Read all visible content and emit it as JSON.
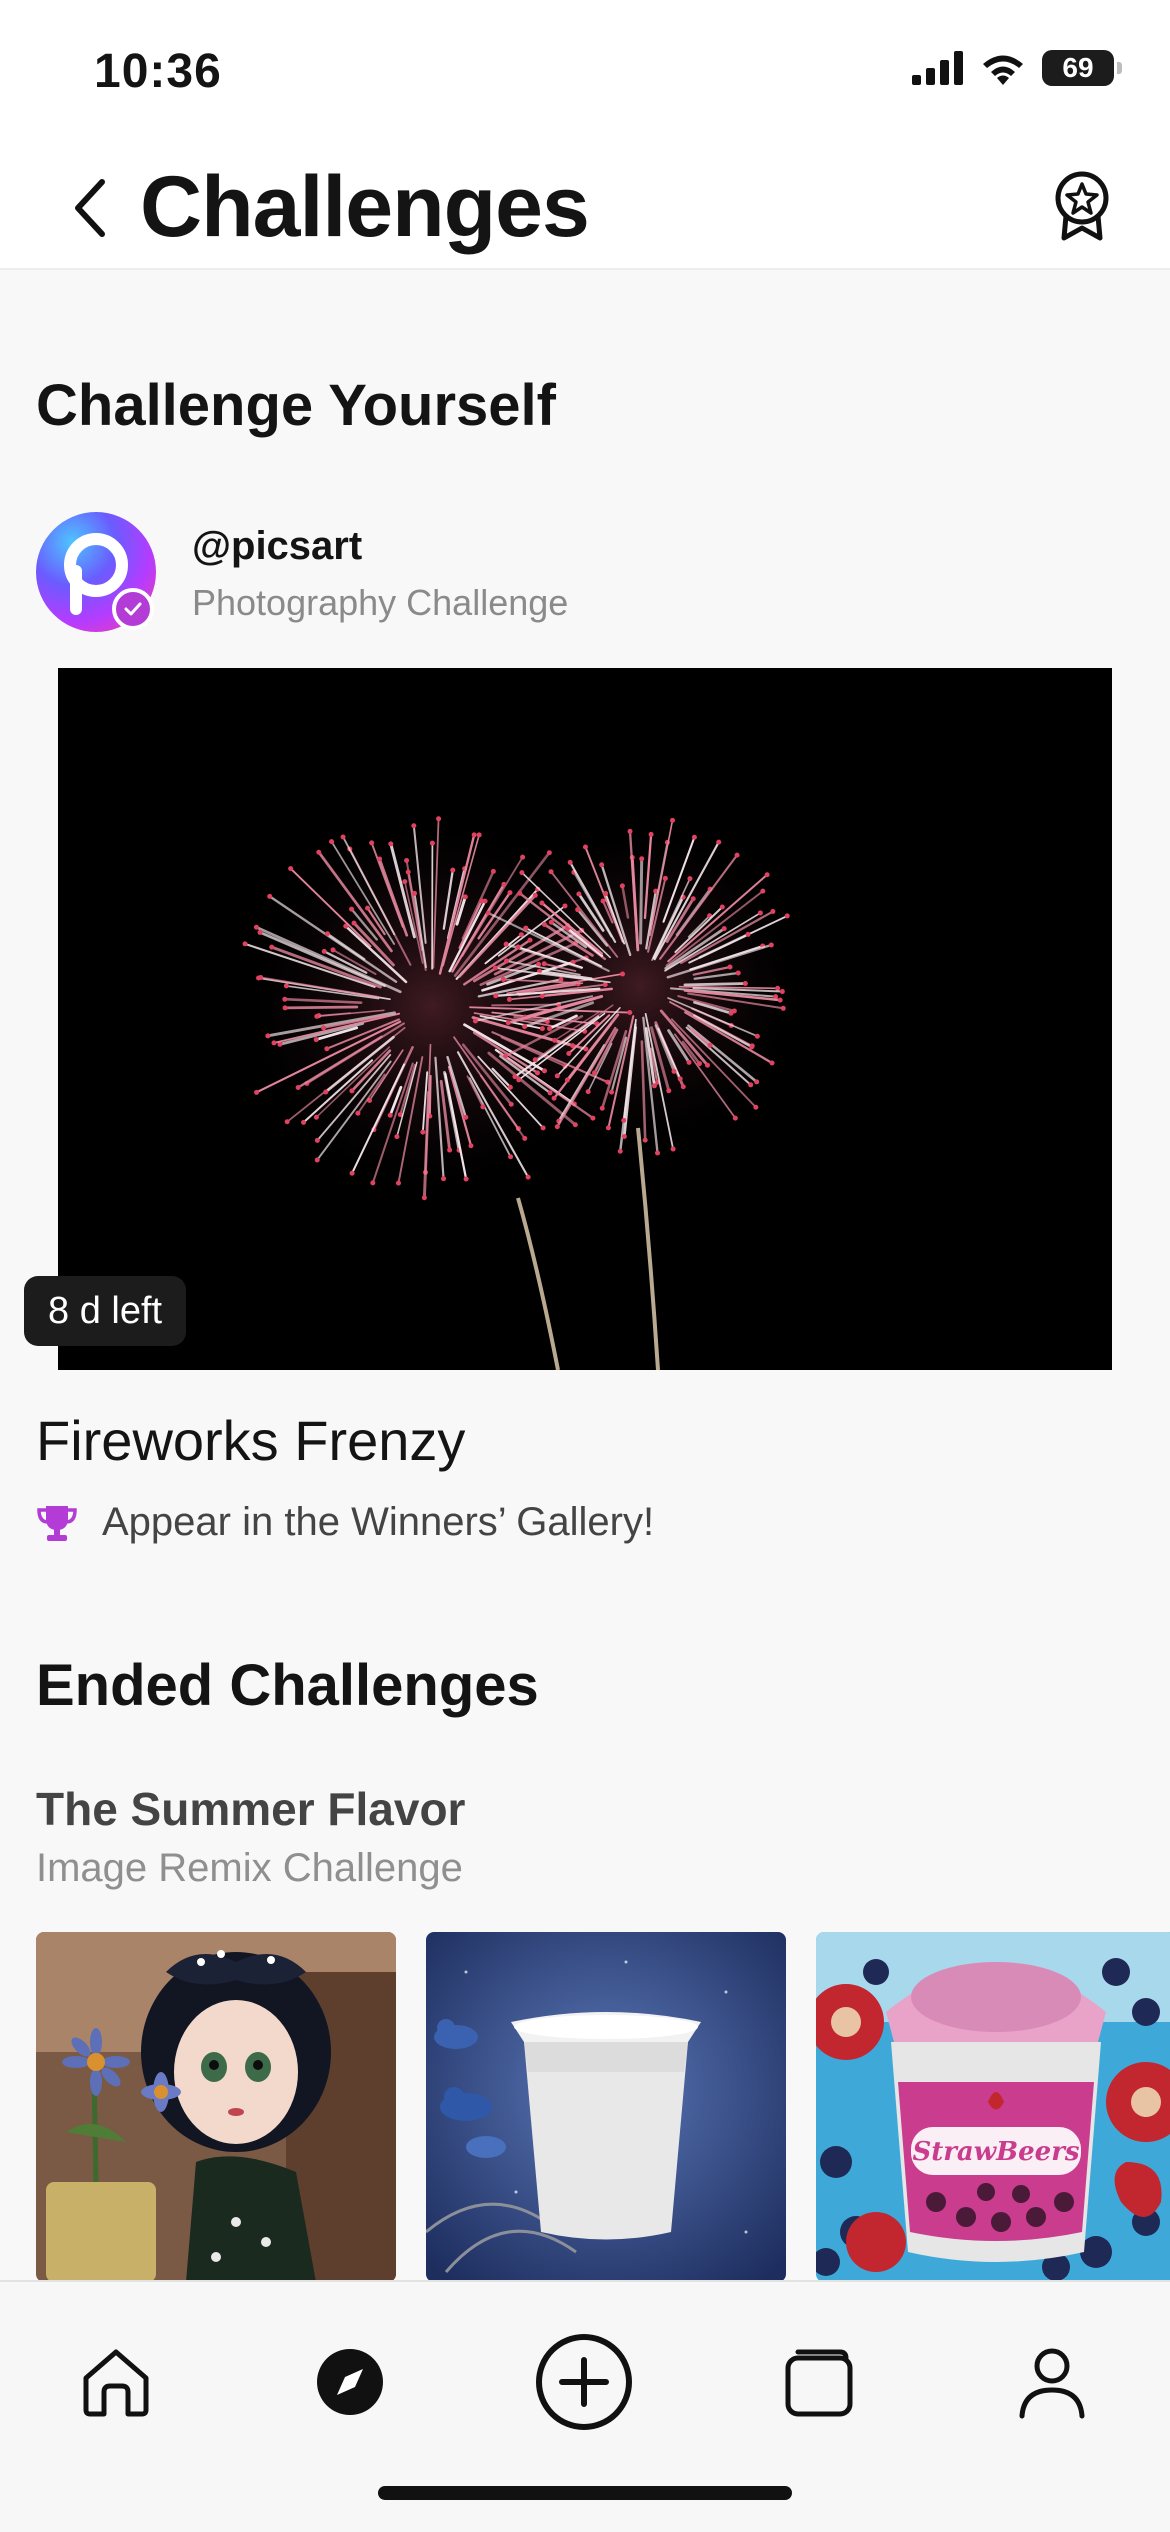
{
  "status_bar": {
    "time": "10:36",
    "battery": "69"
  },
  "header": {
    "title": "Challenges"
  },
  "challenge_yourself": {
    "section_title": "Challenge Yourself",
    "creator_handle": "@picsart",
    "challenge_type": "Photography Challenge",
    "time_left": "8 d left",
    "challenge_name": "Fireworks Frenzy",
    "prize_text": "Appear in the Winners’ Gallery!"
  },
  "ended_challenges": {
    "section_title": "Ended Challenges",
    "item_title": "The Summer Flavor",
    "item_subtitle": "Image Remix Challenge",
    "cup_label": "StrawBeers"
  },
  "colors": {
    "accent_purple": "#b43cd6",
    "text_primary": "#141414",
    "text_secondary": "#8a8a8a",
    "background": "#f8f8f9"
  },
  "icons": {
    "back": "chevron-left-icon",
    "award": "award-star-icon",
    "verified": "checkmark-icon",
    "trophy": "trophy-icon",
    "home": "home-icon",
    "explore": "compass-icon",
    "create": "plus-circle-icon",
    "collections": "folder-icon",
    "profile": "person-icon"
  }
}
